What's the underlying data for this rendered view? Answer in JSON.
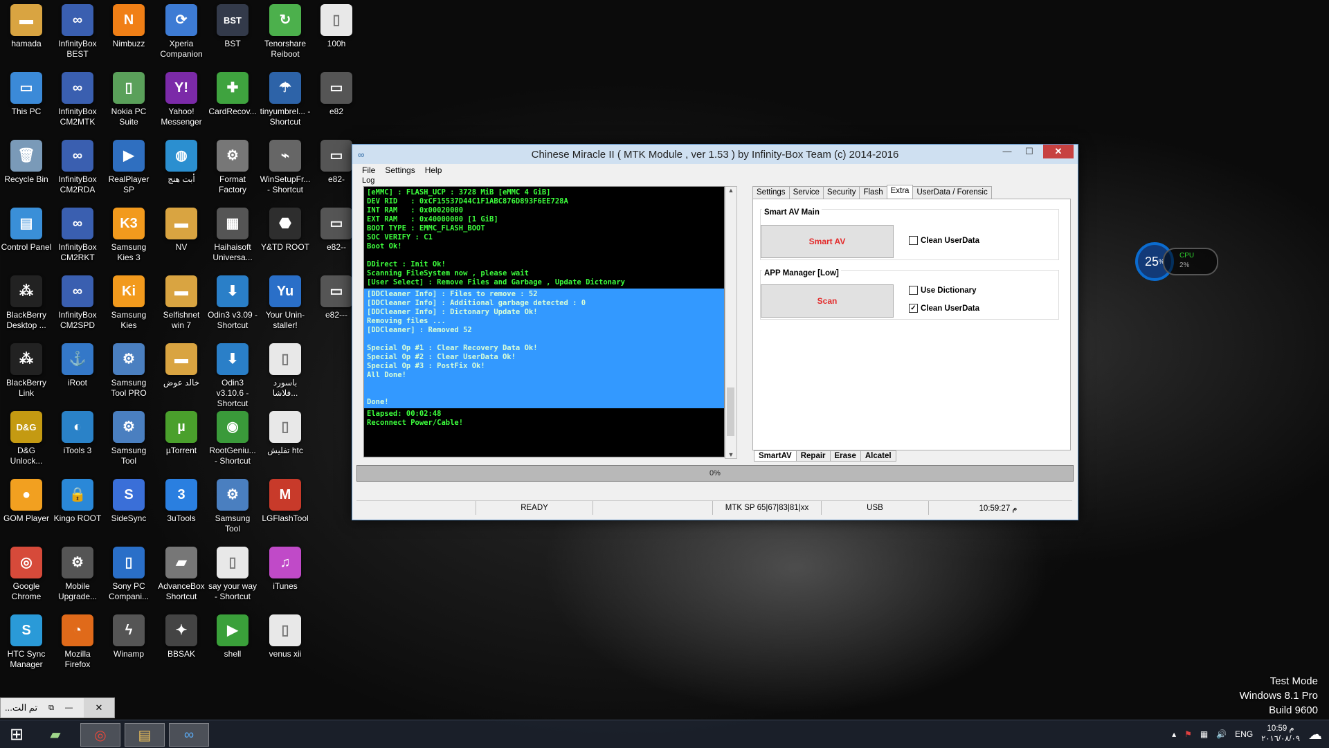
{
  "desktop_icons": [
    {
      "label": "hamada",
      "col": 0,
      "row": 0,
      "glyph": "folder-icon",
      "symbol": "▬",
      "color": "#d9a441"
    },
    {
      "label": "InfinityBox BEST",
      "col": 1,
      "row": 0,
      "glyph": "infinity-icon",
      "symbol": "∞",
      "color": "#3a5fb0"
    },
    {
      "label": "Nimbuzz",
      "col": 2,
      "row": 0,
      "glyph": "nimbuzz-icon",
      "symbol": "N",
      "color": "#f07f16"
    },
    {
      "label": "Xperia Companion",
      "col": 3,
      "row": 0,
      "glyph": "xperia-icon",
      "symbol": "⟳",
      "color": "#3d7bd4"
    },
    {
      "label": "BST",
      "col": 4,
      "row": 0,
      "glyph": "bst-icon",
      "symbol": "BST",
      "color": "#333a4a"
    },
    {
      "label": "Tenorshare Reiboot",
      "col": 5,
      "row": 0,
      "glyph": "reiboot-icon",
      "symbol": "↻",
      "color": "#4cb04c"
    },
    {
      "label": "100h",
      "col": 6,
      "row": 0,
      "glyph": "file-icon",
      "symbol": "▯",
      "color": "#e8e8e8"
    },
    {
      "label": "This PC",
      "col": 0,
      "row": 1,
      "glyph": "computer-icon",
      "symbol": "▭",
      "color": "#3b8ad8"
    },
    {
      "label": "InfinityBox CM2MTK",
      "col": 1,
      "row": 1,
      "glyph": "infinity-icon",
      "symbol": "∞",
      "color": "#3a5fb0"
    },
    {
      "label": "Nokia PC Suite",
      "col": 2,
      "row": 1,
      "glyph": "nokia-icon",
      "symbol": "▯",
      "color": "#5aa05a"
    },
    {
      "label": "Yahoo! Messenger",
      "col": 3,
      "row": 1,
      "glyph": "yahoo-icon",
      "symbol": "Y!",
      "color": "#7b2aa8"
    },
    {
      "label": "CardRecov...",
      "col": 4,
      "row": 1,
      "glyph": "cardrecovery-icon",
      "symbol": "✚",
      "color": "#3fa33f"
    },
    {
      "label": "tinyumbrel... - Shortcut",
      "col": 5,
      "row": 1,
      "glyph": "umbrella-icon",
      "symbol": "☂",
      "color": "#2d63a8"
    },
    {
      "label": "e82",
      "col": 6,
      "row": 1,
      "glyph": "device-icon",
      "symbol": "▭",
      "color": "#555"
    },
    {
      "label": "Recycle Bin",
      "col": 0,
      "row": 2,
      "glyph": "recycle-bin-icon",
      "symbol": "🗑",
      "color": "#7a9ab8"
    },
    {
      "label": "InfinityBox CM2RDA",
      "col": 1,
      "row": 2,
      "glyph": "infinity-icon",
      "symbol": "∞",
      "color": "#3a5fb0"
    },
    {
      "label": "RealPlayer SP",
      "col": 2,
      "row": 2,
      "glyph": "realplayer-icon",
      "symbol": "▶",
      "color": "#2f6fc0"
    },
    {
      "label": "أبت هنج",
      "col": 3,
      "row": 2,
      "glyph": "globe-icon",
      "symbol": "◍",
      "color": "#2b8fd0"
    },
    {
      "label": "Format Factory",
      "col": 4,
      "row": 2,
      "glyph": "format-factory-icon",
      "symbol": "⚙",
      "color": "#777"
    },
    {
      "label": "WinSetupFr... - Shortcut",
      "col": 5,
      "row": 2,
      "glyph": "usb-icon",
      "symbol": "⌁",
      "color": "#666"
    },
    {
      "label": "e82-",
      "col": 6,
      "row": 2,
      "glyph": "device-icon",
      "symbol": "▭",
      "color": "#555"
    },
    {
      "label": "Control Panel",
      "col": 0,
      "row": 3,
      "glyph": "control-panel-icon",
      "symbol": "▤",
      "color": "#3a8fd8"
    },
    {
      "label": "InfinityBox CM2RKT",
      "col": 1,
      "row": 3,
      "glyph": "infinity-icon",
      "symbol": "∞",
      "color": "#3a5fb0"
    },
    {
      "label": "Samsung Kies 3",
      "col": 2,
      "row": 3,
      "glyph": "kies-icon",
      "symbol": "K3",
      "color": "#f29a1d"
    },
    {
      "label": "NV",
      "col": 3,
      "row": 3,
      "glyph": "folder-icon",
      "symbol": "▬",
      "color": "#d9a441"
    },
    {
      "label": "Haihaisoft Universa...",
      "col": 4,
      "row": 3,
      "glyph": "haihaisoft-icon",
      "symbol": "▦",
      "color": "#555"
    },
    {
      "label": "Y&TD ROOT",
      "col": 5,
      "row": 3,
      "glyph": "android-icon",
      "symbol": "⬣",
      "color": "#2e2e2e"
    },
    {
      "label": "e82--",
      "col": 6,
      "row": 3,
      "glyph": "device-icon",
      "symbol": "▭",
      "color": "#555"
    },
    {
      "label": "BlackBerry Desktop ...",
      "col": 0,
      "row": 4,
      "glyph": "blackberry-icon",
      "symbol": "⁂",
      "color": "#222"
    },
    {
      "label": "InfinityBox CM2SPD",
      "col": 1,
      "row": 4,
      "glyph": "infinity-icon",
      "symbol": "∞",
      "color": "#3a5fb0"
    },
    {
      "label": "Samsung Kies",
      "col": 2,
      "row": 4,
      "glyph": "kies-icon",
      "symbol": "Ki",
      "color": "#f29a1d"
    },
    {
      "label": "Selfishnet win 7",
      "col": 3,
      "row": 4,
      "glyph": "folder-icon",
      "symbol": "▬",
      "color": "#d9a441"
    },
    {
      "label": "Odin3 v3.09 - Shortcut",
      "col": 4,
      "row": 4,
      "glyph": "odin-icon",
      "symbol": "⬇",
      "color": "#2a7fc8"
    },
    {
      "label": "Your Unin-staller!",
      "col": 5,
      "row": 4,
      "glyph": "uninstaller-icon",
      "symbol": "Yu",
      "color": "#2a6fc8"
    },
    {
      "label": "e82---",
      "col": 6,
      "row": 4,
      "glyph": "device-icon",
      "symbol": "▭",
      "color": "#555"
    },
    {
      "label": "BlackBerry Link",
      "col": 0,
      "row": 5,
      "glyph": "blackberry-icon",
      "symbol": "⁂",
      "color": "#222"
    },
    {
      "label": "iRoot",
      "col": 1,
      "row": 5,
      "glyph": "anchor-icon",
      "symbol": "⚓",
      "color": "#3478c8"
    },
    {
      "label": "Samsung Tool PRO",
      "col": 2,
      "row": 5,
      "glyph": "gear-icon",
      "symbol": "⚙",
      "color": "#4a7fc0"
    },
    {
      "label": "خالد عوض",
      "col": 3,
      "row": 5,
      "glyph": "folder-icon",
      "symbol": "▬",
      "color": "#d9a441"
    },
    {
      "label": "Odin3 v3.10.6 - Shortcut",
      "col": 4,
      "row": 5,
      "glyph": "odin-icon",
      "symbol": "⬇",
      "color": "#2a7fc8"
    },
    {
      "label": "باسورد فلاشا...",
      "col": 5,
      "row": 5,
      "glyph": "file-icon",
      "symbol": "▯",
      "color": "#e8e8e8"
    },
    {
      "label": "D&G Unlock...",
      "col": 0,
      "row": 6,
      "glyph": "dg-icon",
      "symbol": "D&G",
      "color": "#c49a12"
    },
    {
      "label": "iTools 3",
      "col": 1,
      "row": 6,
      "glyph": "itools-icon",
      "symbol": "◐",
      "color": "#2a82c8"
    },
    {
      "label": "Samsung Tool",
      "col": 2,
      "row": 6,
      "glyph": "gear-icon",
      "symbol": "⚙",
      "color": "#4a7fc0"
    },
    {
      "label": "µTorrent",
      "col": 3,
      "row": 6,
      "glyph": "utorrent-icon",
      "symbol": "µ",
      "color": "#4aa02c"
    },
    {
      "label": "RootGeniu... - Shortcut",
      "col": 4,
      "row": 6,
      "glyph": "rootgenius-icon",
      "symbol": "◉",
      "color": "#3a9a3a"
    },
    {
      "label": "تفليش htc",
      "col": 5,
      "row": 6,
      "glyph": "file-icon",
      "symbol": "▯",
      "color": "#e8e8e8"
    },
    {
      "label": "GOM Player",
      "col": 0,
      "row": 7,
      "glyph": "gom-icon",
      "symbol": "●",
      "color": "#f2a020"
    },
    {
      "label": "Kingo ROOT",
      "col": 1,
      "row": 7,
      "glyph": "kingo-icon",
      "symbol": "🔒",
      "color": "#2a88d8"
    },
    {
      "label": "SideSync",
      "col": 2,
      "row": 7,
      "glyph": "sidesync-icon",
      "symbol": "S",
      "color": "#3a6fd8"
    },
    {
      "label": "3uTools",
      "col": 3,
      "row": 7,
      "glyph": "3utools-icon",
      "symbol": "3",
      "color": "#2a7fe0"
    },
    {
      "label": "Samsung Tool",
      "col": 4,
      "row": 7,
      "glyph": "gear-icon",
      "symbol": "⚙",
      "color": "#4a7fc0"
    },
    {
      "label": "LGFlashTool",
      "col": 5,
      "row": 7,
      "glyph": "lgflash-icon",
      "symbol": "M",
      "color": "#c83a2a"
    },
    {
      "label": "Google Chrome",
      "col": 0,
      "row": 8,
      "glyph": "chrome-icon",
      "symbol": "◎",
      "color": "#d64a3a"
    },
    {
      "label": "Mobile Upgrade...",
      "col": 1,
      "row": 8,
      "glyph": "gear-icon",
      "symbol": "⚙",
      "color": "#555"
    },
    {
      "label": "Sony PC Compani...",
      "col": 2,
      "row": 8,
      "glyph": "sony-icon",
      "symbol": "▯",
      "color": "#2a6fc8"
    },
    {
      "label": "AdvanceBox Shortcut",
      "col": 3,
      "row": 8,
      "glyph": "advancebox-icon",
      "symbol": "▰",
      "color": "#777"
    },
    {
      "label": "say your way - Shortcut",
      "col": 4,
      "row": 8,
      "glyph": "file-icon",
      "symbol": "▯",
      "color": "#e8e8e8"
    },
    {
      "label": "iTunes",
      "col": 5,
      "row": 8,
      "glyph": "itunes-icon",
      "symbol": "♫",
      "color": "#c04ac8"
    },
    {
      "label": "HTC Sync Manager",
      "col": 0,
      "row": 9,
      "glyph": "htc-icon",
      "symbol": "S",
      "color": "#2a9ad8"
    },
    {
      "label": "Mozilla Firefox",
      "col": 1,
      "row": 9,
      "glyph": "firefox-icon",
      "symbol": "◔",
      "color": "#e06a1a"
    },
    {
      "label": "Winamp",
      "col": 2,
      "row": 9,
      "glyph": "winamp-icon",
      "symbol": "ϟ",
      "color": "#555"
    },
    {
      "label": "BBSAK",
      "col": 3,
      "row": 9,
      "glyph": "bbsak-icon",
      "symbol": "✦",
      "color": "#444"
    },
    {
      "label": "shell",
      "col": 4,
      "row": 9,
      "glyph": "shell-icon",
      "symbol": "▶",
      "color": "#3aa03a"
    },
    {
      "label": "venus xii",
      "col": 5,
      "row": 9,
      "glyph": "file-icon",
      "symbol": "▯",
      "color": "#e8e8e8"
    }
  ],
  "window": {
    "title": "Chinese Miracle II ( MTK Module , ver 1.53 ) by Infinity-Box Team (c) 2014-2016",
    "controls": {
      "minimize": "—",
      "maximize": "☐",
      "close": "✕"
    },
    "menu": [
      "File",
      "Settings",
      "Help"
    ],
    "log_label": "Log",
    "log_lines_top": [
      "[eMMC] : FLASH_UCP : 3728 MiB [eMMC 4 GiB]",
      "DEV RID   : 0xCF15537D44C1F1ABC876D893F6EE728A",
      "INT RAM   : 0x00020000",
      "EXT RAM   : 0x40000000 [1 GiB]",
      "BOOT TYPE : EMMC_FLASH_BOOT",
      "SOC VERIFY : C1",
      "Boot Ok!",
      "",
      "DDirect : Init Ok!",
      "Scanning FileSystem now , please wait",
      "[User Select] : Remove Files and Garbage , Update Dictonary"
    ],
    "log_lines_selected": [
      "[DDCleaner Info] : Files to remove : 52",
      "[DDCleaner Info] : Additional garbage detected : 0",
      "[DDCleaner Info] : Dictonary Update Ok!",
      "Removing files ...",
      "[DDCleaner] : Removed 52",
      "",
      "Special Op #1 : Clear Recovery Data Ok!",
      "Special Op #2 : Clear UserData Ok!",
      "Special Op #3 : PostFix Ok!",
      "All Done!",
      "",
      "",
      "Done!"
    ],
    "log_lines_bottom": [
      "Elapsed: 00:02:48",
      "Reconnect Power/Cable!"
    ],
    "tabs": [
      "Settings",
      "Service",
      "Security",
      "Flash",
      "Extra",
      "UserData / Forensic"
    ],
    "active_tab": "Extra",
    "smart_av_group": "Smart AV Main",
    "smart_av_button": "Smart AV",
    "smart_av_clean": {
      "label": "Clean UserData",
      "checked": false
    },
    "app_manager_group": "APP Manager [Low]",
    "scan_button": "Scan",
    "use_dictionary": {
      "label": "Use Dictionary",
      "checked": false
    },
    "app_clean": {
      "label": "Clean UserData",
      "checked": true
    },
    "subtabs": [
      "SmartAV",
      "Repair",
      "Erase",
      "Alcatel"
    ],
    "progress_text": "0%",
    "progress_value": 0,
    "status": {
      "state": "READY",
      "platform": "MTK SP 65|67|83|81|xx",
      "port": "USB",
      "time": "10:59:27 م"
    }
  },
  "cpu_widget": {
    "percent": "25",
    "percent_unit": "%",
    "label": "CPU",
    "sub": "2%"
  },
  "watermark": [
    "Test Mode",
    "Windows 8.1 Pro",
    "Build 9600"
  ],
  "mini_window": {
    "title": "...تم الت",
    "restore": "⧉",
    "minimize": "—",
    "close": "✕"
  },
  "taskbar": {
    "start": "⊞",
    "items": [
      {
        "name": "tool-app-icon",
        "symbol": "▰"
      },
      {
        "name": "chrome-icon",
        "symbol": "◎"
      },
      {
        "name": "file-explorer-icon",
        "symbol": "▤"
      },
      {
        "name": "mtk-infinity-icon",
        "symbol": "∞"
      }
    ],
    "tray": {
      "lang": "ENG",
      "time": "10:59 م",
      "date": "٢٠١٦/٠٨/٠٩"
    }
  },
  "colors": {
    "accent": "#3399ff",
    "log_text": "#3dff3d",
    "button_text": "#e32b2b",
    "close": "#c74141"
  }
}
